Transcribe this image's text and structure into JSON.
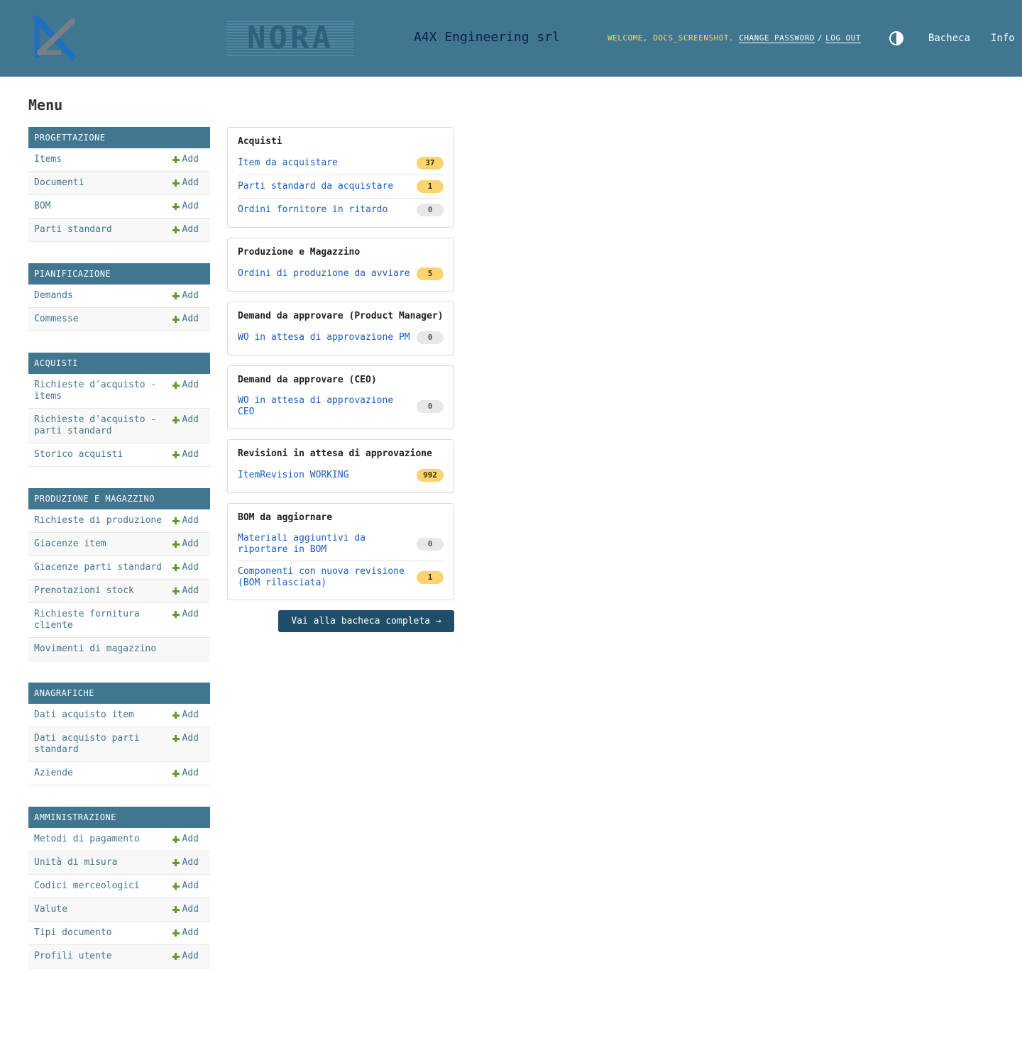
{
  "header": {
    "company": "A4X Engineering srl",
    "logo_text": "NORA",
    "welcome": "WELCOME,",
    "username": "DOCS_SCREENSHOT.",
    "change_password": "CHANGE PASSWORD",
    "separator": "/",
    "logout": "LOG OUT",
    "nav_bacheca": "Bacheca",
    "nav_info": "Info"
  },
  "menu_title": "Menu",
  "add_label": "Add",
  "modules": [
    {
      "caption": "PROGETTAZIONE",
      "items": [
        {
          "label": "Items",
          "add": true
        },
        {
          "label": "Documenti",
          "add": true
        },
        {
          "label": "BOM",
          "add": true
        },
        {
          "label": "Parti standard",
          "add": true
        }
      ]
    },
    {
      "caption": "PIANIFICAZIONE",
      "items": [
        {
          "label": "Demands",
          "add": true
        },
        {
          "label": "Commesse",
          "add": true
        }
      ]
    },
    {
      "caption": "ACQUISTI",
      "items": [
        {
          "label": "Richieste d'acquisto - items",
          "add": true
        },
        {
          "label": "Richieste d'acquisto - parti standard",
          "add": true
        },
        {
          "label": "Storico acquisti",
          "add": true
        }
      ]
    },
    {
      "caption": "PRODUZIONE E MAGAZZINO",
      "items": [
        {
          "label": "Richieste di produzione",
          "add": true
        },
        {
          "label": "Giacenze item",
          "add": true
        },
        {
          "label": "Giacenze parti standard",
          "add": true
        },
        {
          "label": "Prenotazioni stock",
          "add": true
        },
        {
          "label": "Richieste fornitura cliente",
          "add": true
        },
        {
          "label": "Movimenti di magazzino",
          "add": false
        }
      ]
    },
    {
      "caption": "ANAGRAFICHE",
      "items": [
        {
          "label": "Dati acquisto item",
          "add": true
        },
        {
          "label": "Dati acquisto parti standard",
          "add": true
        },
        {
          "label": "Aziende",
          "add": true
        }
      ]
    },
    {
      "caption": "AMMINISTRAZIONE",
      "items": [
        {
          "label": "Metodi di pagamento",
          "add": true
        },
        {
          "label": "Unità di misura",
          "add": true
        },
        {
          "label": "Codici merceologici",
          "add": true
        },
        {
          "label": "Valute",
          "add": true
        },
        {
          "label": "Tipi documento",
          "add": true
        },
        {
          "label": "Profili utente",
          "add": true
        }
      ]
    }
  ],
  "cards": [
    {
      "title": "Acquisti",
      "rows": [
        {
          "label": "Item da acquistare",
          "count": "37"
        },
        {
          "label": "Parti standard da acquistare",
          "count": "1"
        },
        {
          "label": "Ordini fornitore in ritardo",
          "count": "0"
        }
      ]
    },
    {
      "title": "Produzione e Magazzino",
      "rows": [
        {
          "label": "Ordini di produzione da avviare",
          "count": "5"
        }
      ]
    },
    {
      "title": "Demand da approvare (Product Manager)",
      "rows": [
        {
          "label": "WO in attesa di approvazione PM",
          "count": "0"
        }
      ]
    },
    {
      "title": "Demand da approvare (CEO)",
      "rows": [
        {
          "label": "WO in attesa di approvazione CEO",
          "count": "0"
        }
      ]
    },
    {
      "title": "Revisioni in attesa di approvazione",
      "rows": [
        {
          "label": "ItemRevision WORKING",
          "count": "992"
        }
      ]
    },
    {
      "title": "BOM da aggiornare",
      "rows": [
        {
          "label": "Materiali aggiuntivi da riportare in BOM",
          "count": "0"
        },
        {
          "label": "Componenti con nuova revisione (BOM rilasciata)",
          "count": "1"
        }
      ]
    }
  ],
  "full_board_button": "Vai alla bacheca completa →",
  "colors": {
    "header_bg": "#417690",
    "badge_warn": "#fbd46f",
    "badge_zero": "#e8e8e8",
    "add_icon": "#5b9f2a"
  }
}
